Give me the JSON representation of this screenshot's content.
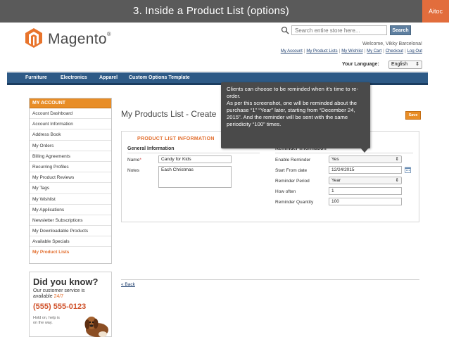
{
  "slide": {
    "title": "3. Inside a Product List (options)",
    "brand": "Aitoc"
  },
  "store": {
    "logo_text": "Magento",
    "logo_mark": "®",
    "search_placeholder": "Search entire store here...",
    "search_button": "Search",
    "welcome": "Welcome, Vikky Barcelona!",
    "toplinks": [
      "My Account",
      "My Product Lists",
      "My Wishlist",
      "My Cart",
      "Checkout",
      "Log Out"
    ],
    "language_label": "Your Language:",
    "language_value": "English",
    "nav": [
      "Furniture",
      "Electronics",
      "Apparel",
      "Custom Options Template"
    ]
  },
  "sidebar": {
    "heading": "MY ACCOUNT",
    "items": [
      {
        "label": "Account Dashboard"
      },
      {
        "label": "Account Information"
      },
      {
        "label": "Address Book"
      },
      {
        "label": "My Orders"
      },
      {
        "label": "Billing Agreements"
      },
      {
        "label": "Recurring Profiles"
      },
      {
        "label": "My Product Reviews"
      },
      {
        "label": "My Tags"
      },
      {
        "label": "My Wishlist"
      },
      {
        "label": "My Applications"
      },
      {
        "label": "Newsletter Subscriptions"
      },
      {
        "label": "My Downloadable Products"
      },
      {
        "label": "Available Specials"
      },
      {
        "label": "My Product Lists"
      }
    ],
    "active_item": "My Product Lists"
  },
  "promo": {
    "title": "Did you know?",
    "line1": "Our customer service is",
    "line2a": "available ",
    "line2b": "24/7",
    "phone": "(555) 555-0123",
    "hold": "Hold on, help is on the way."
  },
  "main": {
    "page_title": "My Products List - Create",
    "save_button": "Save",
    "section_title": "PRODUCT LIST INFORMATION",
    "general_title": "General Information",
    "name_label": "Name",
    "name_required": "*",
    "name_value": "Candy for Kids",
    "notes_label": "Notes",
    "notes_value": "Each Christmas",
    "reminder_title": "Reminder Information",
    "enable_label": "Enable Reminder",
    "enable_value": "Yes",
    "start_label": "Start From date",
    "start_value": "12/24/2015",
    "period_label": "Reminder Period",
    "period_value": "Year",
    "often_label": "How often",
    "often_value": "1",
    "quantity_label": "Reminder Quantity",
    "quantity_value": "100",
    "back_link": "« Back"
  },
  "callout": {
    "text": "Clients can choose to be reminded when it’s time to re-order.\nAs per this screenshot, one will be reminded about the purchase “1” “Year” later, starting from “December 24, 2015”. And the reminder will be sent with the same periodicity “100” times."
  },
  "colors": {
    "accent_orange": "#e88d26",
    "nav_blue": "#2e5a86",
    "slide_bar": "#5a5a5a",
    "brand": "#e26d3c",
    "callout_bg": "#4a4a4a"
  },
  "icons": {
    "logo": "magento-logo-icon",
    "search": "magnifier-icon",
    "calendar": "calendar-icon",
    "select": "updown-chevron-icon"
  }
}
